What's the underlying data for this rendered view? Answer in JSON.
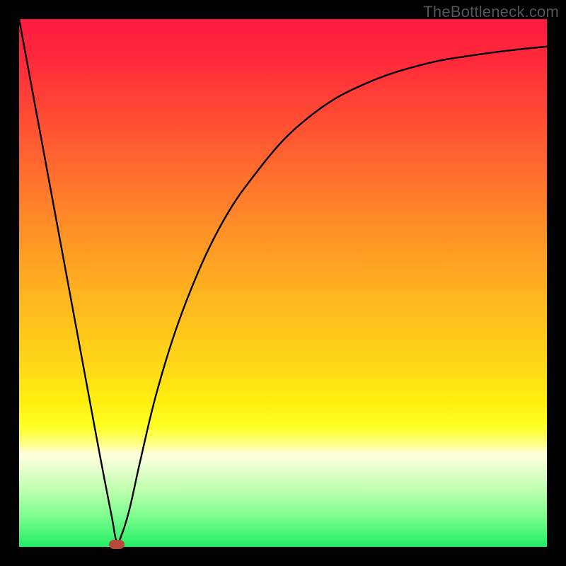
{
  "source_label": "TheBottleneck.com",
  "colors": {
    "frame": "#000000",
    "curve": "#000000",
    "marker": "#b9483c"
  },
  "chart_data": {
    "type": "line",
    "title": "",
    "xlabel": "",
    "ylabel": "",
    "xlim": [
      0,
      1
    ],
    "ylim": [
      0,
      1
    ],
    "grid": false,
    "legend": false,
    "note": "Axes are unlabeled in the image; x and y are normalized 0–1. y≈0 is optimal (green), y≈1 is worst (red). Curve is V-shaped with minimum near x≈0.185.",
    "series": [
      {
        "name": "bottleneck-curve",
        "x": [
          0.0,
          0.05,
          0.1,
          0.15,
          0.175,
          0.185,
          0.195,
          0.21,
          0.23,
          0.26,
          0.3,
          0.35,
          0.4,
          0.45,
          0.5,
          0.55,
          0.6,
          0.65,
          0.7,
          0.75,
          0.8,
          0.85,
          0.9,
          0.95,
          1.0
        ],
        "y": [
          1.0,
          0.73,
          0.46,
          0.19,
          0.06,
          0.01,
          0.025,
          0.075,
          0.165,
          0.29,
          0.42,
          0.545,
          0.64,
          0.71,
          0.77,
          0.815,
          0.85,
          0.875,
          0.895,
          0.91,
          0.922,
          0.93,
          0.937,
          0.943,
          0.948
        ]
      }
    ],
    "marker": {
      "x": 0.185,
      "y": 0.005
    }
  }
}
